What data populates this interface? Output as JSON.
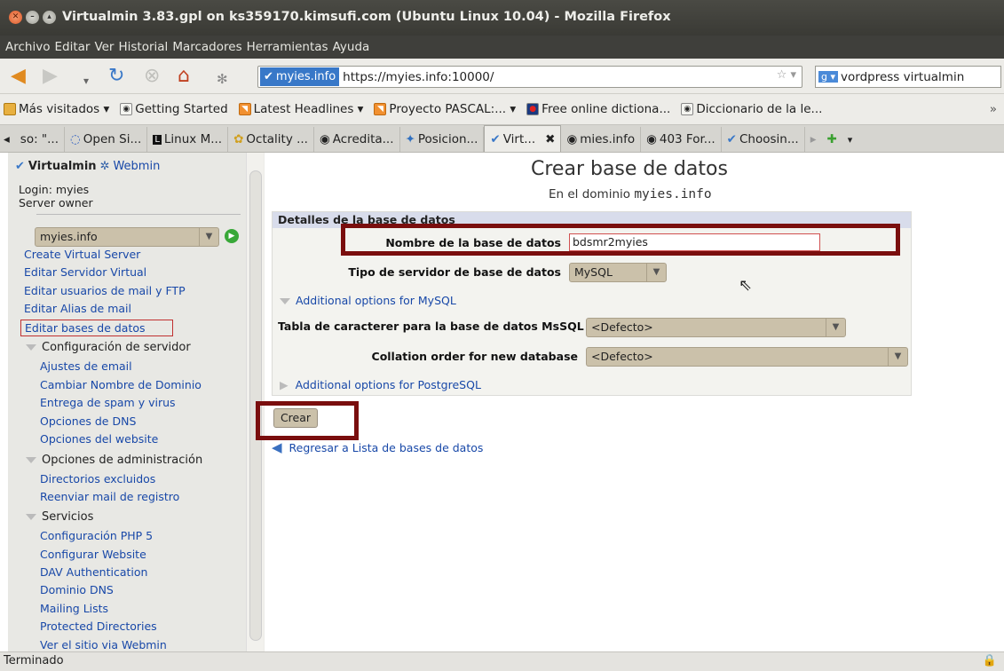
{
  "window": {
    "title": "Virtualmin 3.83.gpl on ks359170.kimsufi.com (Ubuntu Linux 10.04) - Mozilla Firefox"
  },
  "menu": [
    "Archivo",
    "Editar",
    "Ver",
    "Historial",
    "Marcadores",
    "Herramientas",
    "Ayuda"
  ],
  "urlbar": {
    "site": "myies.info",
    "url": "https://myies.info:10000/"
  },
  "search": {
    "value": "vordpress virtualmin"
  },
  "bookmarks": [
    "Más visitados ▾",
    "Getting Started",
    "Latest Headlines ▾",
    "Proyecto PASCAL:... ▾",
    "Free online dictiona...",
    "Diccionario de la le..."
  ],
  "tabs": [
    "so: \"...",
    "Open Si...",
    "Linux M...",
    "Octality ...",
    "Acredita...",
    "Posicion...",
    "Virt...",
    "mies.info",
    "403 For...",
    "Choosin..."
  ],
  "sidebar": {
    "brand": "Virtualmin",
    "webmin": "Webmin",
    "login": "Login: myies",
    "role": "Server owner",
    "domain": "myies.info",
    "links_top": [
      "Create Virtual Server",
      "Editar Servidor Virtual",
      "Editar usuarios de mail y FTP",
      "Editar Alias de mail",
      "Editar bases de datos"
    ],
    "section_config": "Configuración de servidor",
    "links_config": [
      "Ajustes de email",
      "Cambiar Nombre de Dominio",
      "Entrega de spam y virus",
      "Opciones de DNS",
      "Opciones del website"
    ],
    "section_admin": "Opciones de administración",
    "links_admin": [
      "Directorios excluidos",
      "Reenviar mail de registro"
    ],
    "section_services": "Servicios",
    "links_services": [
      "Configuración PHP 5",
      "Configurar Website",
      "DAV Authentication",
      "Dominio DNS",
      "Mailing Lists",
      "Protected Directories",
      "Ver el sitio via Webmin"
    ]
  },
  "main": {
    "title": "Crear base de datos",
    "subtitle_prefix": "En el dominio",
    "subtitle_domain": "myies.info",
    "panel_header": "Detalles de la base de datos",
    "label_name": "Nombre de la base de datos",
    "value_name": "bdsmr2myies",
    "label_type": "Tipo de servidor de base de datos",
    "value_type": "MySQL",
    "mysql_options": "Additional options for MySQL",
    "label_charset": "Tabla de caracterer para la base de datos MsSQL",
    "value_charset": "<Defecto>",
    "label_collation": "Collation order for new database",
    "value_collation": "<Defecto>",
    "postgres_options": "Additional options for PostgreSQL",
    "create_button": "Crear",
    "back_link": "Regresar a Lista de bases de datos"
  },
  "status": {
    "text": "Terminado"
  },
  "colors": {
    "highlight": "#7a0e0e",
    "link": "#1848a8",
    "titlebar": "#3f3f3b"
  }
}
